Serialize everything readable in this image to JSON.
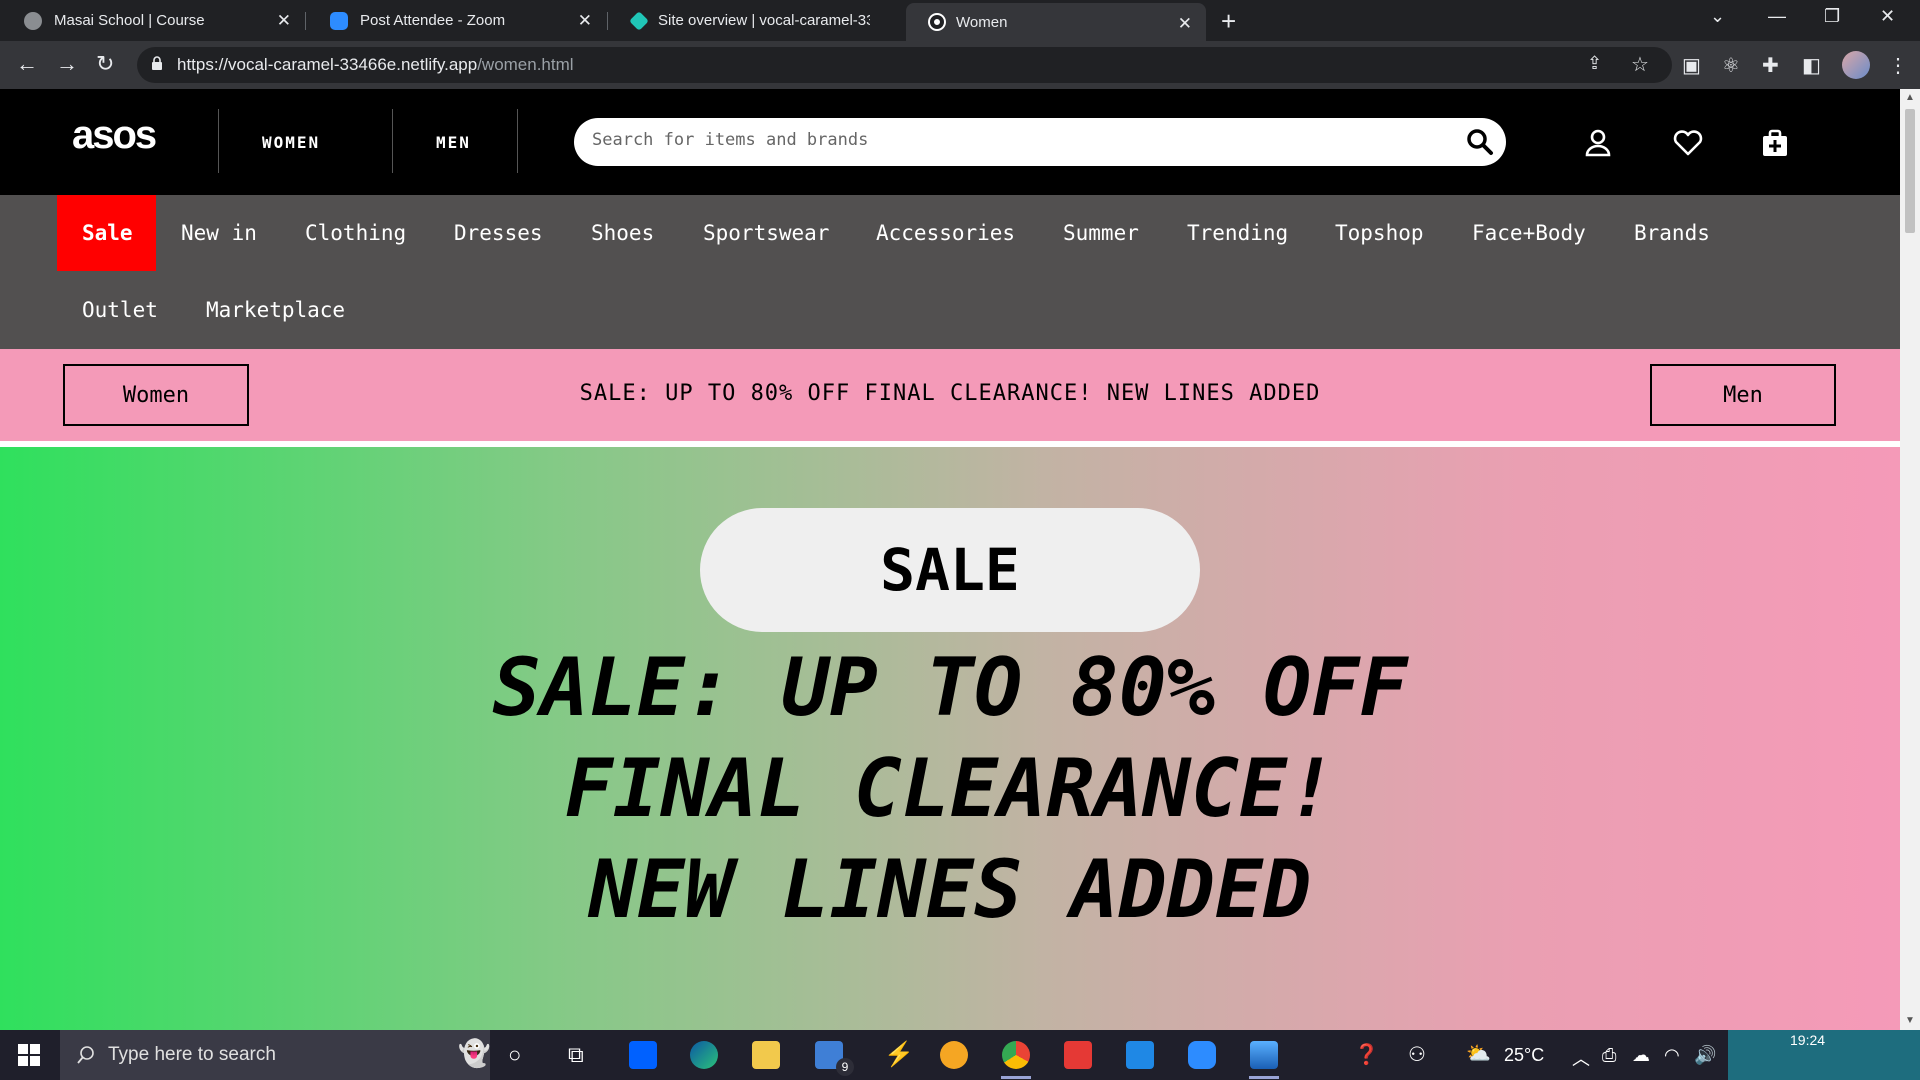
{
  "browser": {
    "tabs": [
      {
        "title": "Masai School | Course",
        "favicon": "globe-icon",
        "active": false
      },
      {
        "title": "Post Attendee - Zoom",
        "favicon": "zoom-icon",
        "active": false
      },
      {
        "title": "Site overview | vocal-caramel-33",
        "favicon": "netlify-icon",
        "active": false
      },
      {
        "title": "Women",
        "favicon": "asos-icon",
        "active": true
      }
    ],
    "url_host": "https://vocal-caramel-33466e.netlify.app",
    "url_path": "/women.html"
  },
  "site": {
    "logo": "asos",
    "gender_links": [
      "WOMEN",
      "MEN"
    ],
    "search_placeholder": "Search for items and brands",
    "header_icons": [
      "account-icon",
      "heart-icon",
      "bag-icon"
    ],
    "categories_row1": [
      "Sale",
      "New in",
      "Clothing",
      "Dresses",
      "Shoes",
      "Sportswear",
      "Accessories",
      "Summer",
      "Trending",
      "Topshop",
      "Face+Body",
      "Brands"
    ],
    "categories_row2": [
      "Outlet",
      "Marketplace"
    ],
    "promo": {
      "left_button": "Women",
      "text": "SALE: UP TO 80% OFF FINAL CLEARANCE! NEW LINES ADDED",
      "right_button": "Men"
    },
    "hero": {
      "pill": "SALE",
      "lines": [
        "SALE: UP TO 80% OFF",
        "FINAL CLEARANCE!",
        "NEW LINES ADDED"
      ]
    },
    "colors": {
      "sale_red": "#ff0000",
      "nav_gray": "#525050",
      "promo_pink": "#f49ab8",
      "hero_green": "#2fe05d"
    }
  },
  "taskbar": {
    "search_placeholder": "Type here to search",
    "mail_badge": "9",
    "temperature": "25°C",
    "time": "19:24"
  }
}
